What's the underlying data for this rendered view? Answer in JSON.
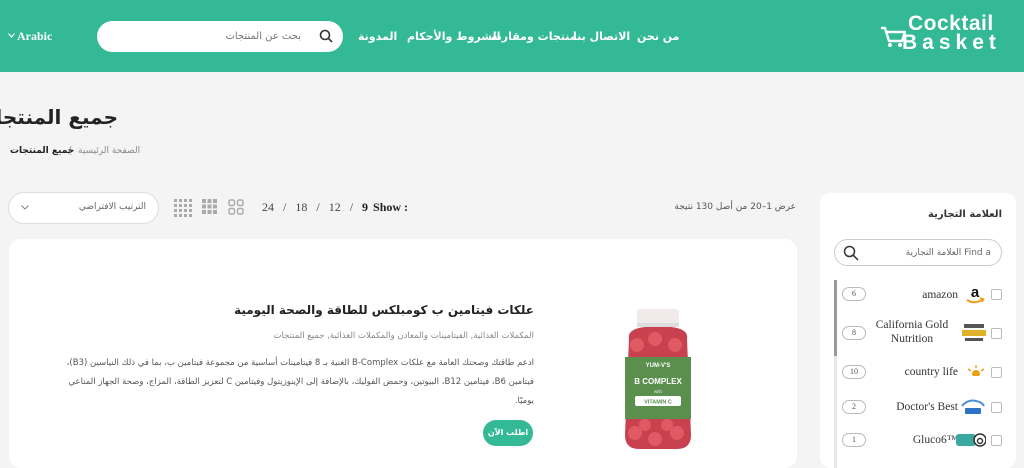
{
  "brand": {
    "line1": "Cocktail",
    "line2": "Basket"
  },
  "colors": {
    "accent": "#33b996",
    "background": "#f4f4f5"
  },
  "nav": {
    "about": "من نحن",
    "contact": "الاتصال بنا",
    "products": "منتجات ومقارنة",
    "terms": "الشروط والأحكام",
    "blog": "المدونة"
  },
  "search": {
    "placeholder": "بحث عن المنتجات",
    "icon": "search-icon"
  },
  "language": "Arabic",
  "page": {
    "title": "جميع المنتجات"
  },
  "breadcrumb": {
    "home": "الصفحة الرئيسية",
    "separator": "/",
    "current": "جميع المنتجات"
  },
  "toolbar": {
    "sort_label": "الترتيب الافتراضي",
    "show_label": "Show :",
    "show_options": [
      "9",
      "12",
      "18",
      "24"
    ],
    "show_separator": "/",
    "result_count": "عرض 1–20 من أصل 130 نتيجة"
  },
  "sidebar": {
    "title": "العلامة التجارية",
    "search_placeholder": "Find a العلامة التجارية",
    "brands": [
      {
        "name": "amazon",
        "count": "6",
        "logo": "amazon-logo"
      },
      {
        "name": "California Gold Nutrition",
        "count": "8",
        "logo": "california-gold-logo"
      },
      {
        "name": "country life",
        "count": "10",
        "logo": "country-life-logo"
      },
      {
        "name": "Doctor's Best",
        "count": "2",
        "logo": "doctors-best-logo"
      },
      {
        "name": "Gluco6™",
        "count": "1",
        "logo": "gluco6-logo"
      }
    ]
  },
  "product": {
    "title": "علكات فيتامين ب كومبلكس للطاقة والصحة اليومية",
    "categories": "المكملات الغذائية, الفيتامينات والمعادن والمكملات الغذائية, جميع المنتجات",
    "description": "ادعم طاقتك وصحتك العامة مع علكات B-Complex الغنية بـ 8 فيتامينات أساسية من مجموعة فيتامين ب، بما في ذلك النياسين (B3)، فيتامين B6، فيتامين B12، البيوتين، وحمض الفوليك، بالإضافة إلى الإينوزيتول وفيتامين C لتعزيز الطاقة، المزاج، وصحة الجهاز المناعي يوميًا.",
    "button": "اطلب الآن",
    "image_labels": {
      "brand": "YUM-V'S",
      "name": "B COMPLEX",
      "with": "with",
      "sub": "VITAMIN C"
    }
  }
}
